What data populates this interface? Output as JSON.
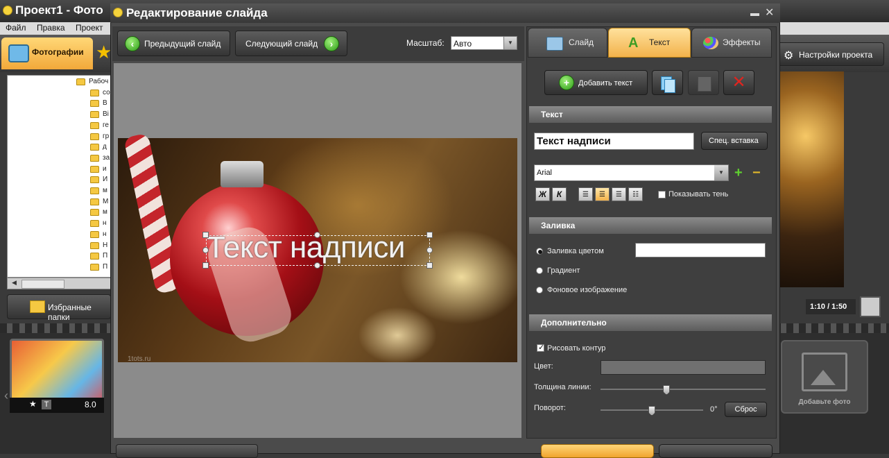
{
  "background_app": {
    "title": "Проект1 - Фото",
    "menu": [
      "Файл",
      "Правка",
      "Проект"
    ],
    "photos_tab": "Фотографии",
    "favorites_button": "Избранные папки",
    "project_settings": "Настройки проекта",
    "time": "1:10 / 1:50",
    "thumbnail_duration": "8.0",
    "add_photo": "Добавьте фото",
    "tree_items": [
      "Рабоч",
      "со",
      "В",
      "Ві",
      "ге",
      "гр",
      "д",
      "за",
      "и",
      "И",
      "м",
      "М",
      "м",
      "н",
      "н",
      "Н",
      "П",
      "П"
    ]
  },
  "dialog": {
    "title": "Редактирование слайда",
    "prev_slide": "Предыдущий слайд",
    "next_slide": "Следующий слайд",
    "scale_label": "Масштаб:",
    "scale_value": "Авто",
    "slide_text": "Текст надписи",
    "watermark": "1tots.ru"
  },
  "panel": {
    "tabs": [
      {
        "label": "Слайд",
        "icon": "slide-icon",
        "active": false
      },
      {
        "label": "Текст",
        "icon": "text-icon",
        "active": true
      },
      {
        "label": "Эффекты",
        "icon": "palette-icon",
        "active": false
      }
    ],
    "add_text": "Добавить текст",
    "section_text": "Текст",
    "text_value": "Текст надписи",
    "special_insert": "Спец. вставка",
    "font_value": "Arial",
    "bold_label": "Ж",
    "italic_label": "К",
    "show_shadow": "Показывать тень",
    "section_fill": "Заливка",
    "fill_color": "Заливка цветом",
    "fill_gradient": "Градиент",
    "fill_background": "Фоновое изображение",
    "section_extra": "Дополнительно",
    "draw_outline": "Рисовать контур",
    "color_label": "Цвет:",
    "line_width_label": "Толщина линии:",
    "rotation_label": "Поворот:",
    "rotation_value": "0°",
    "reset": "Сброс",
    "line_width_level": 0.4,
    "rotation_level": 0.5
  },
  "colors": {
    "accent_orange": "#f2b24b",
    "green_icon": "#2c9b16",
    "delete_red": "#e0251f"
  }
}
